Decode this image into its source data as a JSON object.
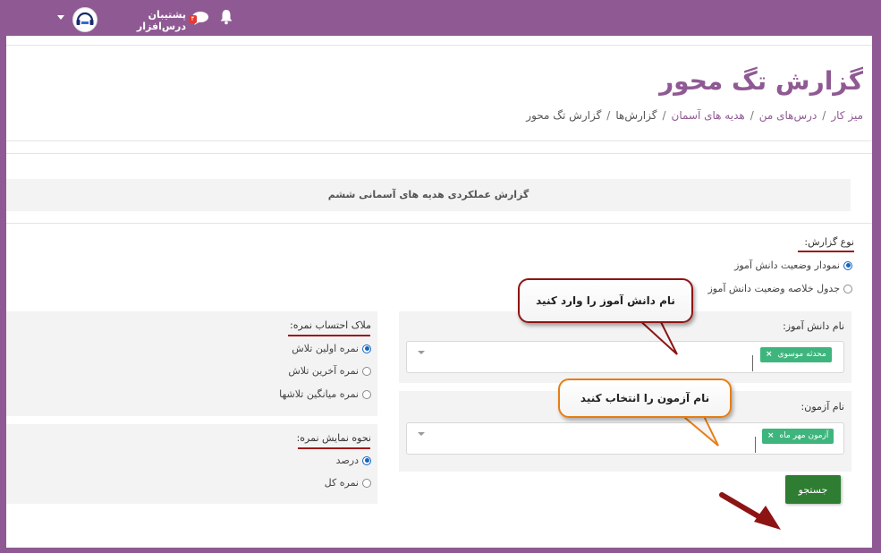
{
  "topbar": {
    "user_name": "پشتیبان درس‌افزار",
    "notification_count": "۴",
    "icons": [
      "bell-icon",
      "chat-icon",
      "user-avatar",
      "chevron-down-icon"
    ]
  },
  "page": {
    "title": "گزارش تگ محور",
    "breadcrumb": [
      "میز کار",
      "درس‌های من",
      "هدیه های آسمان",
      "گزارش‌ها",
      "گزارش تگ محور"
    ]
  },
  "report": {
    "section_title": "گزارش عملکردی هدیه های آسمانی ششم",
    "report_type": {
      "label": "نوع گزارش:",
      "options": [
        "نمودار وضعیت دانش آموز",
        "جدول خلاصه وضعیت دانش آموز"
      ],
      "selected": 0
    },
    "student": {
      "label": "نام دانش آموز:",
      "chip": "محدثه موسوی"
    },
    "exam": {
      "label": "نام آزمون:",
      "chip": "آزمون مهر ماه"
    },
    "grade_criteria": {
      "label": "ملاک احتساب نمره:",
      "options": [
        "نمره اولین تلاش",
        "نمره آخرین تلاش",
        "نمره میانگین تلاشها"
      ],
      "selected": 0
    },
    "grade_display": {
      "label": "نحوه نمایش نمره:",
      "options": [
        "درصد",
        "نمره کل"
      ],
      "selected": 0
    },
    "search_button": "جستجو"
  },
  "annotations": {
    "student_callout": "نام دانش آموز را وارد کنید",
    "exam_callout": "نام آزمون را انتخاب کنید",
    "colors": {
      "red": "#8e1414",
      "orange": "#e87d13"
    }
  },
  "colors": {
    "brand": "#8f5a93",
    "button": "#2e7d32",
    "chip": "#3fb57e",
    "selected_radio": "#1565c0"
  }
}
